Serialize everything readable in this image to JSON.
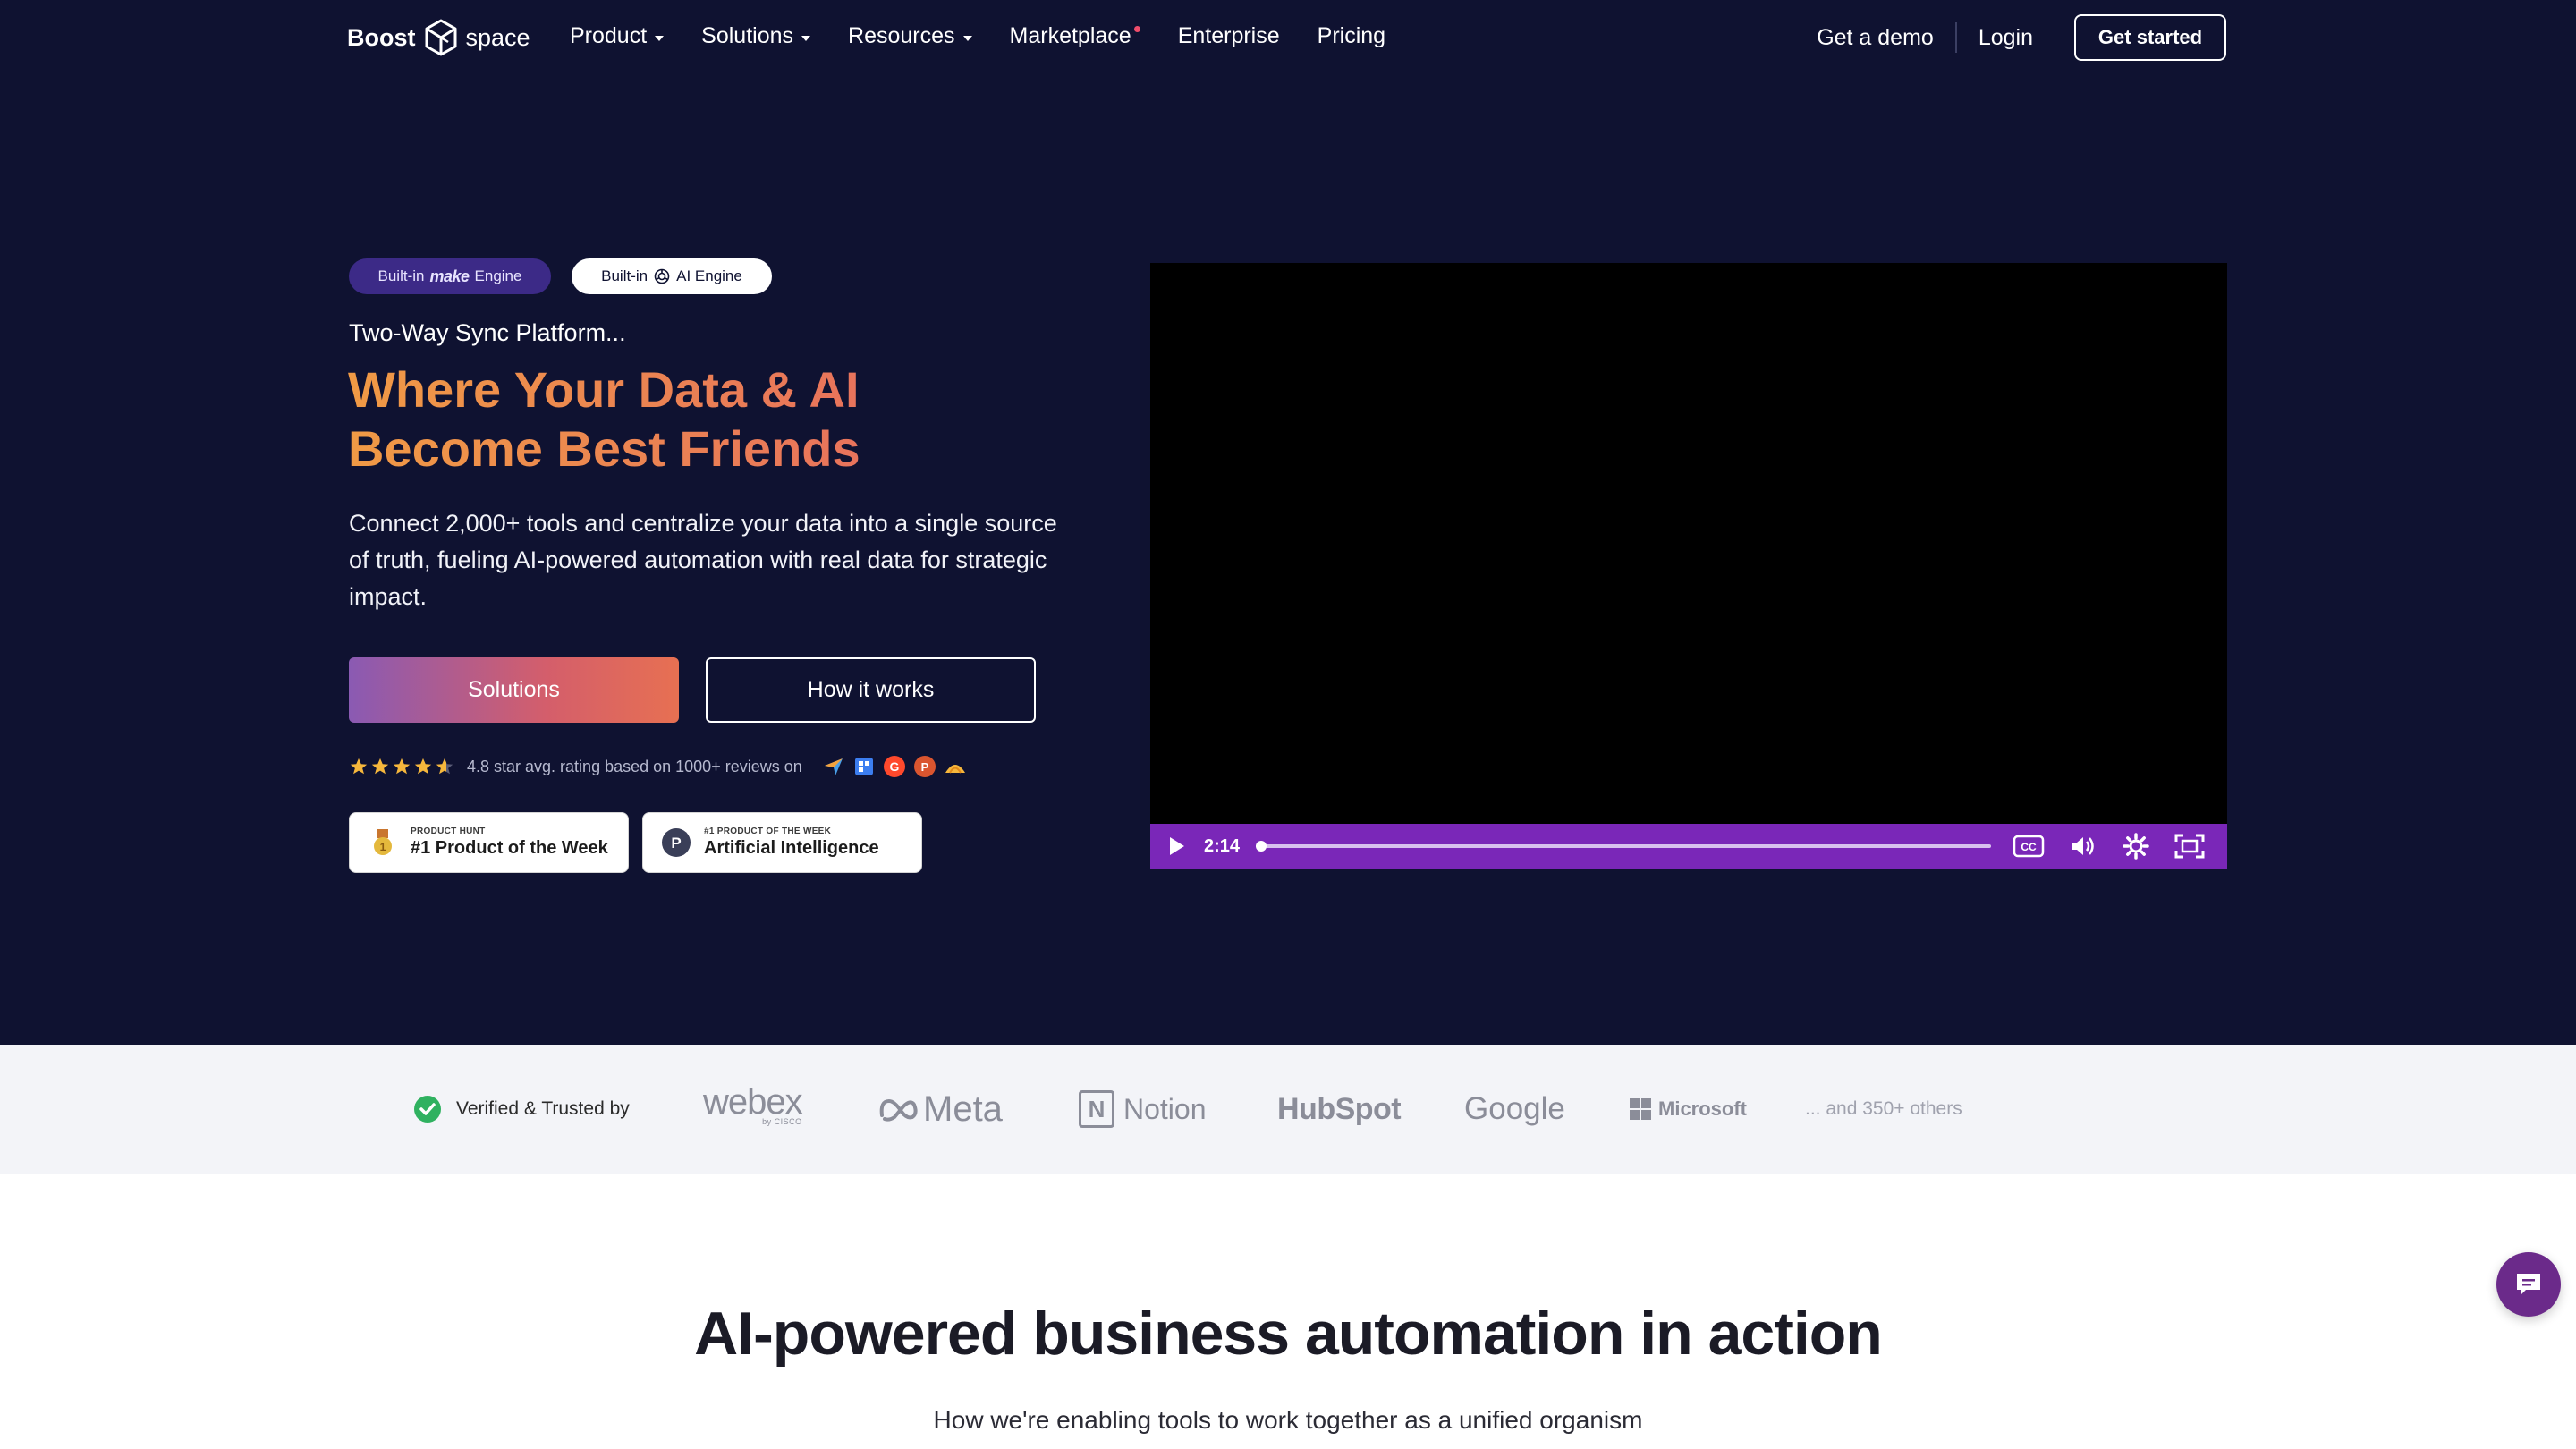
{
  "nav": {
    "logo_left": "Boost",
    "logo_right": "space",
    "links": [
      {
        "label": "Product",
        "has_caret": true
      },
      {
        "label": "Solutions",
        "has_caret": true
      },
      {
        "label": "Resources",
        "has_caret": true
      },
      {
        "label": "Marketplace",
        "has_caret": false
      },
      {
        "label": "Enterprise",
        "has_caret": false
      },
      {
        "label": "Pricing",
        "has_caret": false
      }
    ],
    "demo": "Get a demo",
    "login": "Login",
    "get_started": "Get started"
  },
  "hero": {
    "badge_make_prefix": "Built-in",
    "badge_make_brand": "make",
    "badge_make_suffix": "Engine",
    "badge_ai_prefix": "Built-in",
    "badge_ai_suffix": "AI Engine",
    "eyebrow": "Two-Way Sync Platform...",
    "headline": "Where Your Data & AI Become Best Friends",
    "subtext": "Connect 2,000+ tools and centralize your data into a single source of truth, fueling AI-powered automation with real data for strategic impact.",
    "btn_solutions": "Solutions",
    "btn_how": "How it works",
    "rating_text": "4.8 star avg. rating based on 1000+ reviews on",
    "rating_value": 4.8,
    "awards": [
      {
        "small": "PRODUCT HUNT",
        "big": "#1 Product of the Week"
      },
      {
        "small": "#1 PRODUCT OF THE WEEK",
        "big": "Artificial Intelligence"
      }
    ]
  },
  "video": {
    "time": "2:14",
    "progress": 0.0
  },
  "trusted": {
    "label": "Verified & Trusted by",
    "brands": [
      "webex",
      "Meta",
      "Notion",
      "HubSpot",
      "Google",
      "Microsoft"
    ],
    "webex_sub": "by CISCO",
    "others": "... and 350+ others"
  },
  "section": {
    "title": "AI-powered business automation in action",
    "subtitle": "How we're enabling tools to work together as a unified organism"
  },
  "colors": {
    "hero_bg": "#0f1231",
    "accent_orange": "#f09a45",
    "video_bar": "#7a27b8",
    "chat": "#6b2a8a"
  }
}
